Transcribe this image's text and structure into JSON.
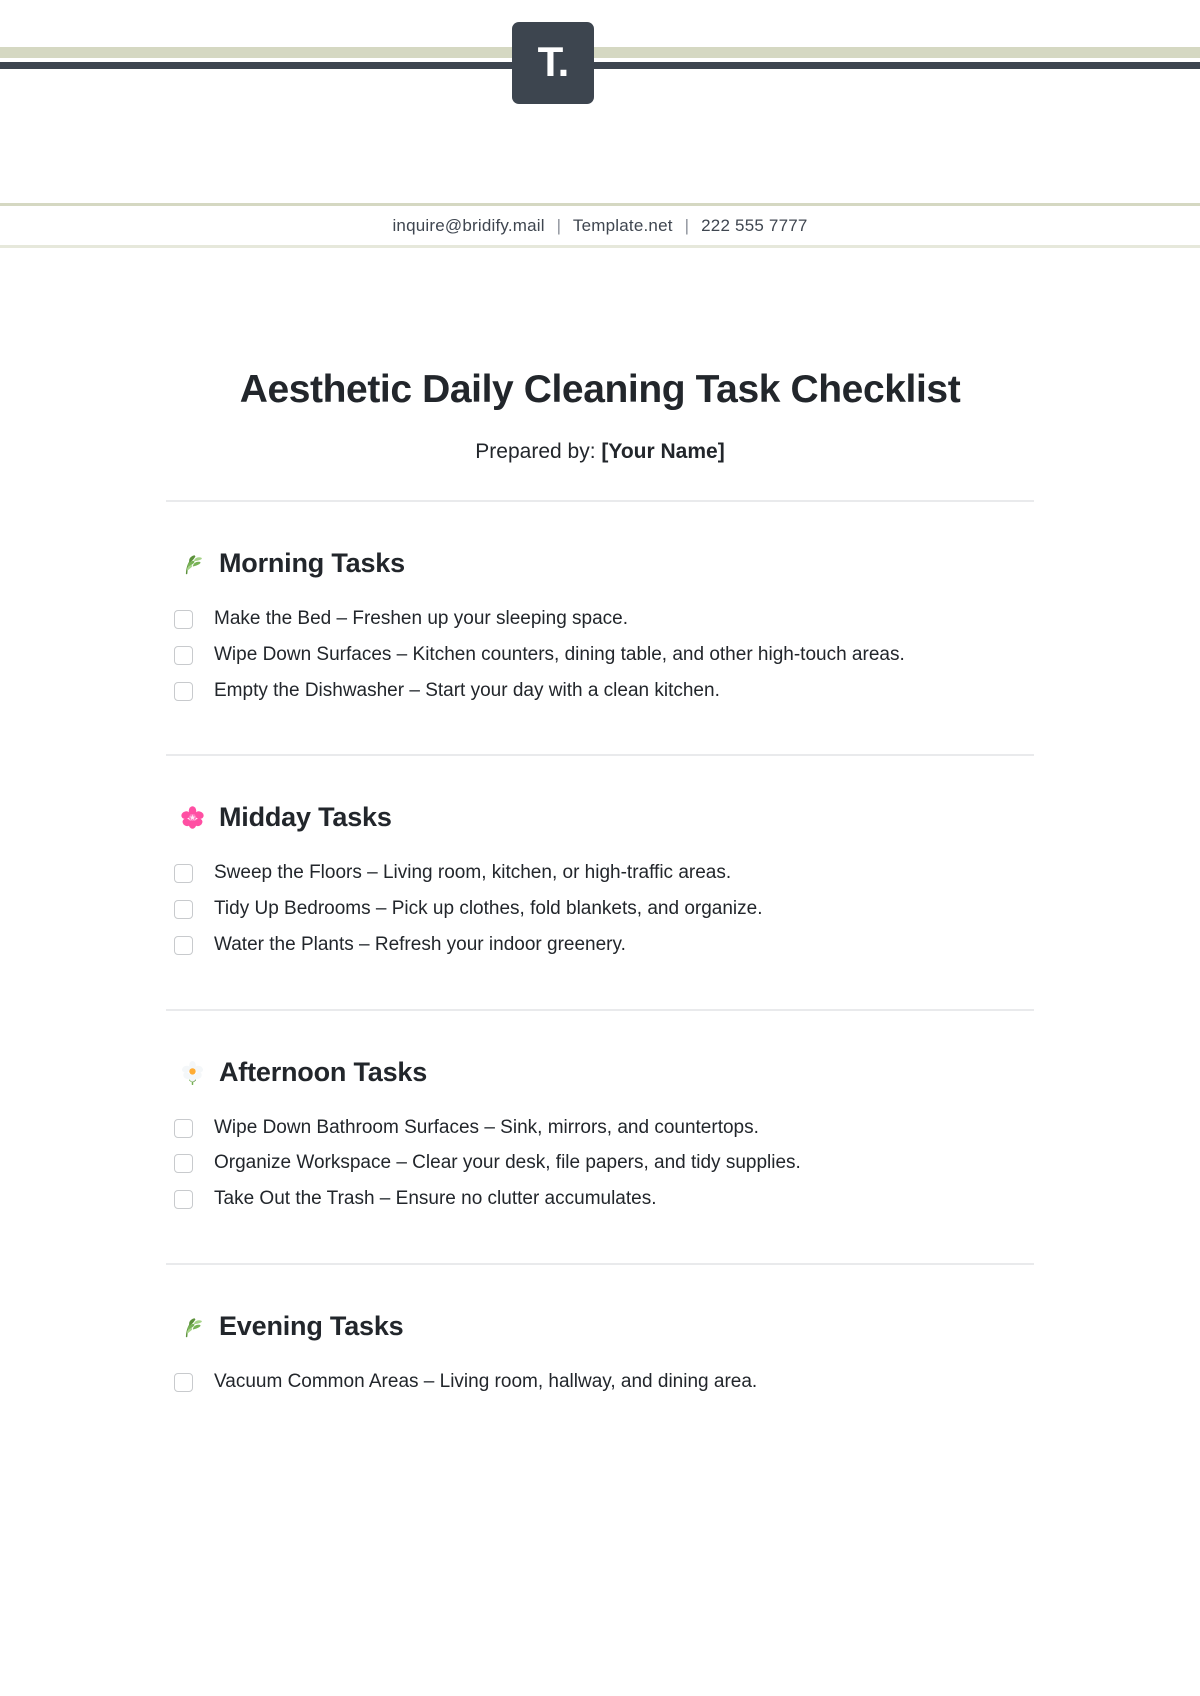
{
  "brand": {
    "logo_letter": "T.",
    "logo_bg_color": "#3d454f",
    "rule_sage_color": "#d5d8c2",
    "rule_dark_color": "#3d454f"
  },
  "contact": {
    "email": "inquire@bridify.mail",
    "separator": "|",
    "website": "Template.net",
    "phone": "222 555 7777"
  },
  "document": {
    "title": "Aesthetic Daily Cleaning Task Checklist",
    "prepared_by_label": "Prepared by:",
    "prepared_by_value": "[Your Name]"
  },
  "sections": [
    {
      "icon": "herb-leaf-icon",
      "emoji": "herb",
      "title": "Morning Tasks",
      "tasks": [
        "Make the Bed – Freshen up your sleeping space.",
        "Wipe Down Surfaces – Kitchen counters, dining table, and other high-touch areas.",
        "Empty the Dishwasher – Start your day with a clean kitchen."
      ]
    },
    {
      "icon": "cherry-blossom-icon",
      "emoji": "cherry_blossom",
      "title": "Midday Tasks",
      "tasks": [
        "Sweep the Floors – Living room, kitchen, or high-traffic areas.",
        "Tidy Up Bedrooms – Pick up clothes, fold blankets, and organize.",
        "Water the Plants – Refresh your indoor greenery."
      ]
    },
    {
      "icon": "blossom-flower-icon",
      "emoji": "blossom",
      "title": "Afternoon Tasks",
      "tasks": [
        "Wipe Down Bathroom Surfaces – Sink, mirrors, and countertops.",
        "Organize Workspace – Clear your desk, file papers, and tidy supplies.",
        "Take Out the Trash – Ensure no clutter accumulates."
      ]
    },
    {
      "icon": "herb-leaf-icon",
      "emoji": "herb",
      "title": "Evening Tasks",
      "tasks": [
        "Vacuum Common Areas – Living room, hallway, and dining area."
      ]
    }
  ]
}
